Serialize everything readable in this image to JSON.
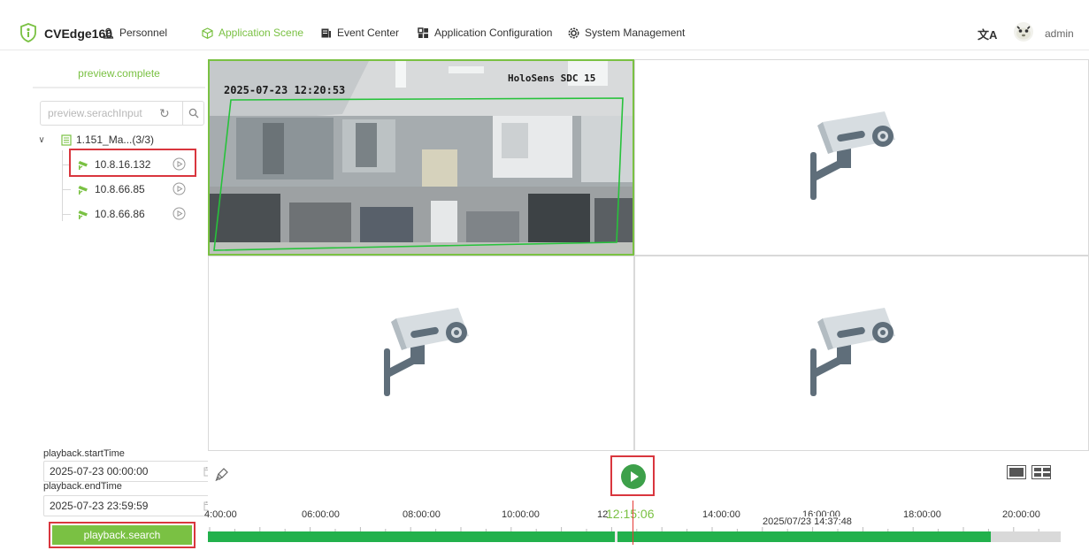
{
  "header": {
    "brand": "CVEdge160",
    "nav": [
      {
        "label": "Personnel",
        "icon": "personnel-icon",
        "active": false
      },
      {
        "label": "Application Scene",
        "icon": "cube-icon",
        "active": true
      },
      {
        "label": "Event Center",
        "icon": "event-icon",
        "active": false
      },
      {
        "label": "Application Configuration",
        "icon": "grid-icon",
        "active": false
      },
      {
        "label": "System Management",
        "icon": "gear-icon",
        "active": false
      }
    ],
    "translate_icon": "文A",
    "user": "admin"
  },
  "sidebar": {
    "tab_label": "preview.complete",
    "search_placeholder": "preview.serachInput",
    "tree_root": "1.151_Ma...(3/3)",
    "devices": [
      {
        "ip": "10.8.16.132",
        "selected": true
      },
      {
        "ip": "10.8.66.85",
        "selected": false
      },
      {
        "ip": "10.8.66.86",
        "selected": false
      }
    ],
    "start_label": "playback.startTime",
    "start_value": "2025-07-23 00:00:00",
    "end_label": "playback.endTime",
    "end_value": "2025-07-23 23:59:59",
    "search_button": "playback.search"
  },
  "video": {
    "feed_timestamp": "2025-07-23 12:20:53",
    "feed_name": "HoloSens SDC 15"
  },
  "timeline": {
    "ticks": [
      "4:00:00",
      "06:00:00",
      "08:00:00",
      "10:00:00",
      "12",
      "14:00:00",
      "16:00:00",
      "18:00:00",
      "20:00:00"
    ],
    "current_time": "12:15:06",
    "hover_time": "2025/07/23 14:37:48",
    "recorded_fraction": 0.918,
    "colors": {
      "accent": "#7ac143",
      "record": "#22b14c",
      "cursor": "#e53935",
      "highlight": "#d9363e"
    }
  }
}
